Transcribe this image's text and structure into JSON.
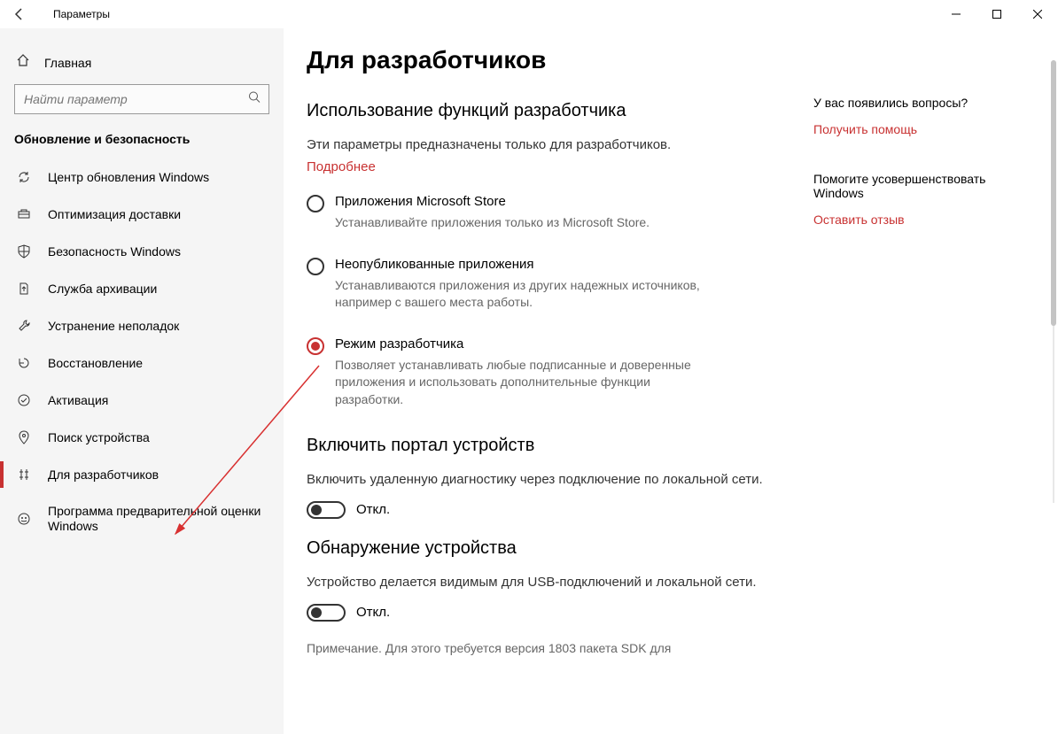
{
  "window": {
    "title": "Параметры"
  },
  "sidebar": {
    "home": "Главная",
    "search_placeholder": "Найти параметр",
    "section": "Обновление и безопасность",
    "items": [
      {
        "label": "Центр обновления Windows"
      },
      {
        "label": "Оптимизация доставки"
      },
      {
        "label": "Безопасность Windows"
      },
      {
        "label": "Служба архивации"
      },
      {
        "label": "Устранение неполадок"
      },
      {
        "label": "Восстановление"
      },
      {
        "label": "Активация"
      },
      {
        "label": "Поиск устройства"
      },
      {
        "label": "Для разработчиков"
      },
      {
        "label": "Программа предварительной оценки Windows"
      }
    ]
  },
  "content": {
    "title": "Для разработчиков",
    "dev_features": {
      "heading": "Использование функций разработчика",
      "desc": "Эти параметры предназначены только для разработчиков.",
      "link": "Подробнее",
      "options": [
        {
          "label": "Приложения Microsoft Store",
          "desc": "Устанавливайте приложения только из Microsoft Store."
        },
        {
          "label": "Неопубликованные приложения",
          "desc": "Устанавливаются приложения из других надежных источников, например с вашего места работы."
        },
        {
          "label": "Режим разработчика",
          "desc": "Позволяет устанавливать любые подписанные и доверенные приложения и использовать дополнительные функции разработки."
        }
      ]
    },
    "portal": {
      "heading": "Включить портал устройств",
      "desc": "Включить удаленную диагностику через подключение по локальной сети.",
      "toggle": "Откл."
    },
    "discovery": {
      "heading": "Обнаружение устройства",
      "desc": "Устройство делается видимым для USB-подключений и локальной сети.",
      "toggle": "Откл.",
      "note": "Примечание. Для этого требуется версия 1803 пакета SDK для"
    }
  },
  "aside": {
    "q_heading": "У вас появились вопросы?",
    "q_link": "Получить помощь",
    "f_heading": "Помогите усовершенствовать Windows",
    "f_link": "Оставить отзыв"
  }
}
